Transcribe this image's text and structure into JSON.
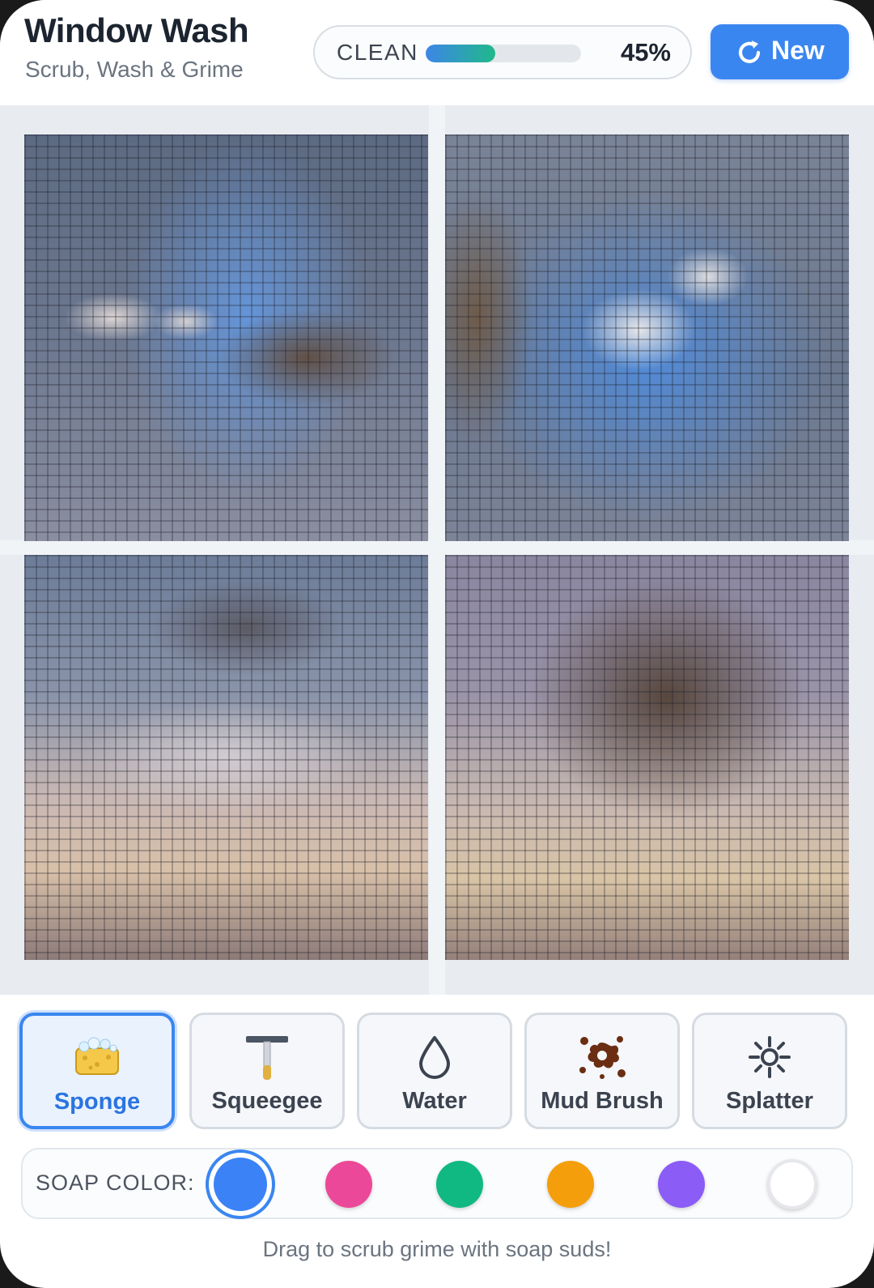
{
  "header": {
    "title": "Window Wash",
    "subtitle": "Scrub, Wash & Grime",
    "meter_label": "CLEAN",
    "clean_percent": 45,
    "clean_percent_text": "45%",
    "new_button": "New"
  },
  "tools": [
    {
      "label": "Sponge",
      "icon": "sponge-icon",
      "active": true
    },
    {
      "label": "Squeegee",
      "icon": "squeegee-icon",
      "active": false
    },
    {
      "label": "Water",
      "icon": "water-drop-icon",
      "active": false
    },
    {
      "label": "Mud Brush",
      "icon": "mud-splat-icon",
      "active": false
    },
    {
      "label": "Splatter",
      "icon": "splatter-icon",
      "active": false
    }
  ],
  "soap": {
    "label": "SOAP COLOR:",
    "colors": [
      "#3b82f6",
      "#ec4899",
      "#10b981",
      "#f59e0b",
      "#8b5cf6",
      "#ffffff"
    ],
    "selected": 0
  },
  "hint": "Drag to scrub grime with soap suds!",
  "colors": {
    "accent": "#3a86f0",
    "meter_fill_start": "#3d86e6",
    "meter_fill_end": "#1fb98a"
  }
}
